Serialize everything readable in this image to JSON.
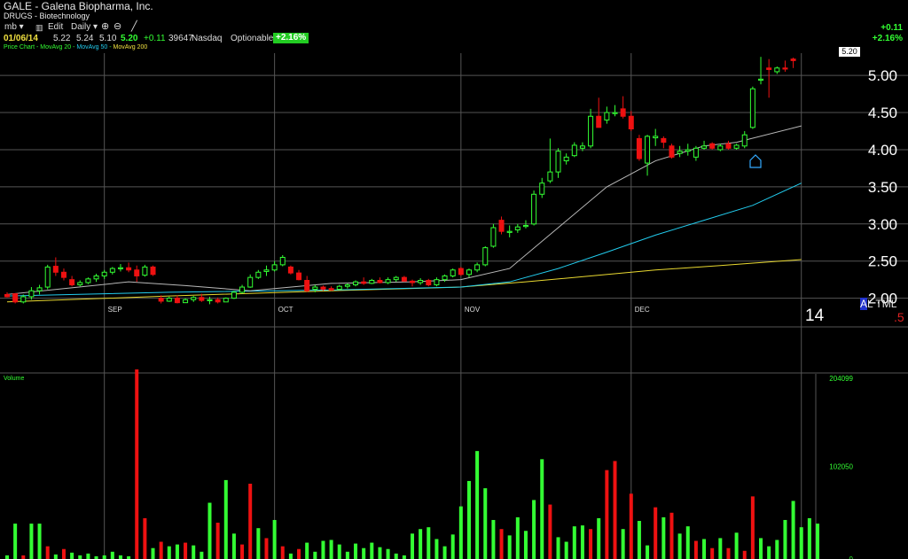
{
  "header": {
    "symbol_title": "GALE - Galena Biopharma, Inc.",
    "industry": "DRUGS - Biotechnology",
    "toolbar": {
      "layout": "mb ▾",
      "bar_icon": "bar-chart-icon",
      "edit": "Edit",
      "period": "Daily ▾",
      "zoom_in_icon": "zoom-in-icon",
      "zoom_out_icon": "zoom-out-icon",
      "draw_icon": "draw-line-icon"
    },
    "quote": {
      "date": "01/06/14",
      "open": "5.22",
      "high": "5.24",
      "low": "5.10",
      "close": "5.20",
      "change": "+0.11",
      "volume": "39647",
      "exchange": "Nasdaq",
      "optionable": "Optionable",
      "pct_change": "+2.16%"
    },
    "ma_legend": {
      "price_chart": "Price Chart",
      "ma20": "MovAvg 20",
      "ma50": "MovAvg 50",
      "ma200": "MovAvg 200"
    },
    "change_abs": "+0.11",
    "change_pct": "+2.16%",
    "last_price_tag": "5.20"
  },
  "branding": {
    "al_a": "A",
    "al_rest": "L TML",
    "year": "14",
    "five": ".5"
  },
  "colors": {
    "up": "#33ff33",
    "down": "#ee1111",
    "ma20": "#b8b8b8",
    "ma50": "#22ccee",
    "ma200": "#e8d830",
    "grid": "#555555"
  },
  "chart_data": [
    {
      "type": "candlestick",
      "title": "GALE - Galena Biopharma, Inc.",
      "ylim": [
        1.9,
        5.3
      ],
      "y_ticks": [
        {
          "v": 2.0,
          "label": "2.00"
        },
        {
          "v": 2.5,
          "label": "2.50"
        },
        {
          "v": 3.0,
          "label": "3.00"
        },
        {
          "v": 3.5,
          "label": "3.50"
        },
        {
          "v": 4.0,
          "label": "4.00"
        },
        {
          "v": 4.5,
          "label": "4.50"
        },
        {
          "v": 5.0,
          "label": "5.00"
        }
      ],
      "x_ticks": [
        {
          "i": 12,
          "label": "SEP"
        },
        {
          "i": 33,
          "label": "OCT"
        },
        {
          "i": 56,
          "label": "NOV"
        },
        {
          "i": 77,
          "label": "DEC"
        },
        {
          "i": 98,
          "label": ""
        }
      ],
      "candles": [
        [
          2.05,
          2.08,
          2.01,
          2.02
        ],
        [
          2.06,
          2.07,
          1.93,
          1.95
        ],
        [
          1.95,
          2.05,
          1.93,
          2.02
        ],
        [
          2.02,
          2.15,
          1.98,
          2.1
        ],
        [
          2.1,
          2.18,
          2.05,
          2.14
        ],
        [
          2.15,
          2.45,
          2.12,
          2.42
        ],
        [
          2.43,
          2.55,
          2.3,
          2.35
        ],
        [
          2.35,
          2.4,
          2.24,
          2.28
        ],
        [
          2.25,
          2.3,
          2.16,
          2.18
        ],
        [
          2.18,
          2.24,
          2.16,
          2.21
        ],
        [
          2.21,
          2.28,
          2.19,
          2.26
        ],
        [
          2.26,
          2.33,
          2.22,
          2.3
        ],
        [
          2.3,
          2.38,
          2.26,
          2.35
        ],
        [
          2.35,
          2.42,
          2.32,
          2.4
        ],
        [
          2.4,
          2.46,
          2.36,
          2.41
        ],
        [
          2.41,
          2.48,
          2.35,
          2.38
        ],
        [
          2.38,
          2.44,
          2.22,
          2.3
        ],
        [
          2.31,
          2.45,
          2.29,
          2.42
        ],
        [
          2.42,
          2.44,
          2.3,
          2.32
        ],
        [
          2.0,
          2.04,
          1.93,
          1.96
        ],
        [
          1.96,
          2.02,
          1.95,
          2.0
        ],
        [
          2.0,
          2.04,
          1.93,
          1.94
        ],
        [
          1.94,
          2.0,
          1.94,
          1.98
        ],
        [
          1.98,
          2.03,
          1.95,
          2.01
        ],
        [
          2.01,
          2.06,
          1.95,
          1.97
        ],
        [
          1.97,
          2.02,
          1.92,
          1.98
        ],
        [
          1.98,
          2.01,
          1.93,
          1.95
        ],
        [
          1.95,
          2.01,
          1.95,
          2.0
        ],
        [
          2.0,
          2.1,
          1.99,
          2.08
        ],
        [
          2.08,
          2.18,
          2.06,
          2.15
        ],
        [
          2.15,
          2.32,
          2.14,
          2.28
        ],
        [
          2.28,
          2.38,
          2.26,
          2.35
        ],
        [
          2.36,
          2.44,
          2.3,
          2.38
        ],
        [
          2.38,
          2.5,
          2.36,
          2.45
        ],
        [
          2.45,
          2.58,
          2.43,
          2.55
        ],
        [
          2.42,
          2.44,
          2.32,
          2.34
        ],
        [
          2.34,
          2.38,
          2.24,
          2.25
        ],
        [
          2.24,
          2.3,
          2.08,
          2.1
        ],
        [
          2.12,
          2.18,
          2.08,
          2.15
        ],
        [
          2.15,
          2.17,
          2.1,
          2.12
        ],
        [
          2.13,
          2.16,
          2.1,
          2.11
        ],
        [
          2.12,
          2.18,
          2.11,
          2.16
        ],
        [
          2.16,
          2.2,
          2.13,
          2.18
        ],
        [
          2.18,
          2.24,
          2.16,
          2.22
        ],
        [
          2.22,
          2.28,
          2.18,
          2.2
        ],
        [
          2.2,
          2.26,
          2.19,
          2.24
        ],
        [
          2.24,
          2.28,
          2.2,
          2.21
        ],
        [
          2.21,
          2.28,
          2.19,
          2.25
        ],
        [
          2.25,
          2.3,
          2.22,
          2.28
        ],
        [
          2.28,
          2.3,
          2.22,
          2.23
        ],
        [
          2.23,
          2.25,
          2.16,
          2.21
        ],
        [
          2.21,
          2.27,
          2.18,
          2.24
        ],
        [
          2.24,
          2.26,
          2.16,
          2.18
        ],
        [
          2.18,
          2.28,
          2.16,
          2.25
        ],
        [
          2.25,
          2.32,
          2.22,
          2.3
        ],
        [
          2.3,
          2.4,
          2.28,
          2.38
        ],
        [
          2.4,
          2.42,
          2.3,
          2.32
        ],
        [
          2.32,
          2.4,
          2.28,
          2.38
        ],
        [
          2.38,
          2.48,
          2.35,
          2.45
        ],
        [
          2.45,
          2.7,
          2.43,
          2.68
        ],
        [
          2.7,
          3.0,
          2.68,
          2.95
        ],
        [
          3.05,
          3.1,
          2.86,
          2.9
        ],
        [
          2.9,
          2.98,
          2.82,
          2.9
        ],
        [
          2.92,
          3.0,
          2.88,
          2.96
        ],
        [
          2.98,
          3.05,
          2.94,
          2.98
        ],
        [
          3.0,
          3.45,
          2.98,
          3.4
        ],
        [
          3.4,
          3.62,
          3.35,
          3.55
        ],
        [
          3.58,
          4.15,
          3.55,
          3.7
        ],
        [
          3.7,
          4.02,
          3.62,
          3.98
        ],
        [
          3.85,
          3.95,
          3.8,
          3.9
        ],
        [
          3.92,
          4.1,
          3.9,
          4.06
        ],
        [
          4.02,
          4.1,
          3.98,
          4.05
        ],
        [
          4.05,
          4.55,
          4.02,
          4.45
        ],
        [
          4.45,
          4.7,
          4.3,
          4.3
        ],
        [
          4.4,
          4.58,
          4.35,
          4.5
        ],
        [
          4.5,
          4.6,
          4.45,
          4.5
        ],
        [
          4.55,
          4.72,
          4.42,
          4.45
        ],
        [
          4.45,
          4.52,
          4.25,
          4.28
        ],
        [
          4.15,
          4.2,
          3.85,
          3.88
        ],
        [
          3.82,
          4.2,
          3.65,
          4.18
        ],
        [
          4.16,
          4.28,
          4.05,
          4.18
        ],
        [
          4.15,
          4.18,
          4.02,
          4.1
        ],
        [
          4.05,
          4.08,
          3.88,
          3.9
        ],
        [
          3.95,
          4.05,
          3.9,
          3.98
        ],
        [
          3.98,
          4.08,
          3.92,
          4.0
        ],
        [
          3.9,
          4.05,
          3.85,
          4.02
        ],
        [
          4.02,
          4.12,
          4.0,
          4.05
        ],
        [
          4.08,
          4.1,
          4.0,
          4.02
        ],
        [
          4.0,
          4.08,
          3.98,
          4.05
        ],
        [
          4.08,
          4.12,
          4.0,
          4.02
        ],
        [
          4.02,
          4.08,
          4.0,
          4.06
        ],
        [
          4.05,
          4.25,
          4.02,
          4.2
        ],
        [
          4.3,
          4.85,
          4.28,
          4.82
        ],
        [
          4.95,
          5.25,
          4.88,
          4.95
        ],
        [
          5.1,
          5.22,
          4.7,
          5.08
        ],
        [
          5.05,
          5.12,
          5.02,
          5.1
        ],
        [
          5.1,
          5.2,
          5.05,
          5.09
        ],
        [
          5.22,
          5.24,
          5.1,
          5.2
        ]
      ],
      "ma20": [
        [
          0,
          2.05
        ],
        [
          15,
          2.22
        ],
        [
          22,
          2.17
        ],
        [
          30,
          2.1
        ],
        [
          40,
          2.2
        ],
        [
          50,
          2.22
        ],
        [
          56,
          2.25
        ],
        [
          62,
          2.4
        ],
        [
          68,
          2.95
        ],
        [
          74,
          3.5
        ],
        [
          80,
          3.85
        ],
        [
          86,
          4.05
        ],
        [
          90,
          4.1
        ],
        [
          98,
          4.32
        ]
      ],
      "ma50": [
        [
          0,
          2.03
        ],
        [
          20,
          2.08
        ],
        [
          40,
          2.11
        ],
        [
          56,
          2.15
        ],
        [
          62,
          2.22
        ],
        [
          68,
          2.4
        ],
        [
          74,
          2.62
        ],
        [
          80,
          2.85
        ],
        [
          86,
          3.05
        ],
        [
          92,
          3.25
        ],
        [
          98,
          3.55
        ]
      ],
      "ma200": [
        [
          0,
          1.95
        ],
        [
          20,
          2.03
        ],
        [
          40,
          2.1
        ],
        [
          56,
          2.15
        ],
        [
          64,
          2.22
        ],
        [
          72,
          2.3
        ],
        [
          80,
          2.38
        ],
        [
          88,
          2.44
        ],
        [
          98,
          2.52
        ]
      ]
    },
    {
      "type": "bar",
      "title": "Volume",
      "ylim": [
        0,
        204099
      ],
      "y_ticks": [
        {
          "v": 204099,
          "label": "204099"
        },
        {
          "v": 102050,
          "label": "102050"
        },
        {
          "v": 0,
          "label": "0"
        }
      ],
      "values": [
        4000,
        39000,
        4000,
        39000,
        39000,
        14000,
        5000,
        11000,
        7000,
        4000,
        6000,
        3000,
        4000,
        8000,
        4000,
        3000,
        209000,
        45000,
        12000,
        19000,
        14000,
        16000,
        18000,
        15000,
        8000,
        62000,
        40000,
        87000,
        28000,
        16000,
        83000,
        34000,
        23000,
        43000,
        14000,
        6000,
        11000,
        18000,
        8000,
        20000,
        21000,
        16000,
        8000,
        17000,
        12000,
        18000,
        13000,
        11000,
        6000,
        4000,
        28000,
        33000,
        35000,
        22000,
        14000,
        27000,
        58000,
        86000,
        119000,
        78000,
        43000,
        33000,
        26000,
        46000,
        31000,
        65000,
        110000,
        60000,
        24000,
        19000,
        36000,
        37000,
        33000,
        45000,
        98000,
        108000,
        33000,
        72000,
        42000,
        15000,
        57000,
        46000,
        51000,
        28000,
        36000,
        20000,
        22000,
        12000,
        23000,
        12000,
        29000,
        9000,
        69000,
        23000,
        14000,
        21000,
        43000,
        64000,
        35000,
        45000,
        39000
      ],
      "directions": [
        "u",
        "u",
        "d",
        "u",
        "u",
        "d",
        "u",
        "d",
        "u",
        "u",
        "u",
        "u",
        "u",
        "u",
        "u",
        "u",
        "d",
        "d",
        "u",
        "d",
        "u",
        "u",
        "d",
        "u",
        "u",
        "u",
        "d",
        "u",
        "u",
        "d",
        "d",
        "u",
        "d",
        "u",
        "d",
        "u",
        "d",
        "u",
        "u",
        "u",
        "u",
        "u",
        "u",
        "u",
        "u",
        "u",
        "u",
        "u",
        "u",
        "u",
        "u",
        "u",
        "u",
        "u",
        "u",
        "u",
        "u",
        "u",
        "u",
        "u",
        "u",
        "d",
        "u",
        "u",
        "u",
        "u",
        "u",
        "d",
        "u",
        "u",
        "u",
        "u",
        "d",
        "u",
        "d",
        "d",
        "u",
        "d",
        "u",
        "u",
        "d",
        "u",
        "d",
        "u",
        "u",
        "d",
        "u",
        "d",
        "u",
        "d",
        "u",
        "d",
        "d",
        "u",
        "u",
        "u",
        "u",
        "u",
        "u",
        "u",
        "u"
      ]
    }
  ]
}
